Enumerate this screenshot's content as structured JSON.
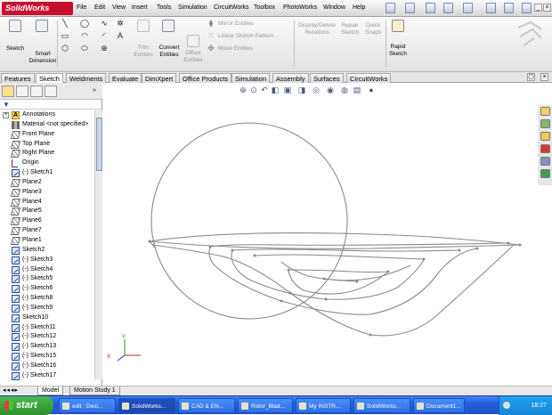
{
  "app": {
    "logo": "SolidWorks",
    "logo_sup": "▸"
  },
  "menu": [
    "File",
    "Edit",
    "View",
    "Insert",
    "Tools",
    "Simulation",
    "CircuitWorks",
    "Toolbox",
    "PhotoWorks",
    "Window",
    "Help"
  ],
  "commands": {
    "sketch": "Sketch",
    "smart_dimension": "Smart\nDimension",
    "trim_entities": "Trim\nEntities",
    "convert_entities": "Convert\nEntities",
    "offset_entities": "Offset\nEntities",
    "mirror_entities": "Mirror Entities",
    "linear_sketch_pattern": "Linear Sketch Pattern",
    "move_entities": "Move Entities",
    "display_delete_relations": "Display/Delete\nRelations",
    "repair_sketch": "Repair\nSketch",
    "quick_snaps": "Quick\nSnaps",
    "rapid_sketch": "Rapid\nSketch"
  },
  "tabs": [
    "Features",
    "Sketch",
    "Weldments",
    "Evaluate",
    "DimXpert",
    "Office Products",
    "Simulation",
    "Assembly",
    "Surfaces",
    "CircuitWorks"
  ],
  "active_tab": "Sketch",
  "tree": [
    {
      "label": "Annotations",
      "icon": "annotations-icon",
      "type": "ann",
      "expand": true
    },
    {
      "label": "Material <not specified>",
      "icon": "material-icon",
      "type": "mat"
    },
    {
      "label": "Front Plane",
      "icon": "plane-icon",
      "type": "plane"
    },
    {
      "label": "Top Plane",
      "icon": "plane-icon",
      "type": "plane"
    },
    {
      "label": "Right Plane",
      "icon": "plane-icon",
      "type": "plane"
    },
    {
      "label": "Origin",
      "icon": "origin-icon",
      "type": "origin"
    },
    {
      "label": "(-) Sketch1",
      "icon": "sketch-icon",
      "type": "sketch"
    },
    {
      "label": "Plane2",
      "icon": "plane-icon",
      "type": "plane"
    },
    {
      "label": "Plane3",
      "icon": "plane-icon",
      "type": "plane"
    },
    {
      "label": "Plane4",
      "icon": "plane-icon",
      "type": "plane"
    },
    {
      "label": "Plane5",
      "icon": "plane-icon",
      "type": "plane"
    },
    {
      "label": "Plane6",
      "icon": "plane-icon",
      "type": "plane"
    },
    {
      "label": "Plane7",
      "icon": "plane-icon",
      "type": "plane"
    },
    {
      "label": "Plane1",
      "icon": "plane-icon",
      "type": "plane"
    },
    {
      "label": "Sketch2",
      "icon": "sketch-icon",
      "type": "sketch"
    },
    {
      "label": "(-) Sketch3",
      "icon": "sketch-icon",
      "type": "sketch"
    },
    {
      "label": "(-) Sketch4",
      "icon": "sketch-icon",
      "type": "sketch"
    },
    {
      "label": "(-) Sketch5",
      "icon": "sketch-icon",
      "type": "sketch"
    },
    {
      "label": "(-) Sketch6",
      "icon": "sketch-icon",
      "type": "sketch"
    },
    {
      "label": "(-) Sketch8",
      "icon": "sketch-icon",
      "type": "sketch"
    },
    {
      "label": "(-) Sketch9",
      "icon": "sketch-icon",
      "type": "sketch"
    },
    {
      "label": "Sketch10",
      "icon": "sketch-icon",
      "type": "sketch"
    },
    {
      "label": "(-) Sketch11",
      "icon": "sketch-icon",
      "type": "sketch"
    },
    {
      "label": "(-) Sketch12",
      "icon": "sketch-icon",
      "type": "sketch"
    },
    {
      "label": "(-) Sketch13",
      "icon": "sketch-icon",
      "type": "sketch"
    },
    {
      "label": "(-) Sketch15",
      "icon": "sketch-icon",
      "type": "sketch"
    },
    {
      "label": "(-) Sketch16",
      "icon": "sketch-icon",
      "type": "sketch"
    },
    {
      "label": "(-) Sketch17",
      "icon": "sketch-icon",
      "type": "sketch"
    }
  ],
  "bottom_tabs": [
    "Model",
    "Motion Study 1"
  ],
  "axis": {
    "x": "X",
    "y": "Y"
  },
  "taskbar": {
    "start": "start",
    "tasks": [
      "edit : Desi...",
      "SolidWorks...",
      "CAD & EN...",
      "Rotor_Blad...",
      "My INSTR...",
      "SolidWorks...",
      "Document1..."
    ],
    "clock": "18:27"
  }
}
